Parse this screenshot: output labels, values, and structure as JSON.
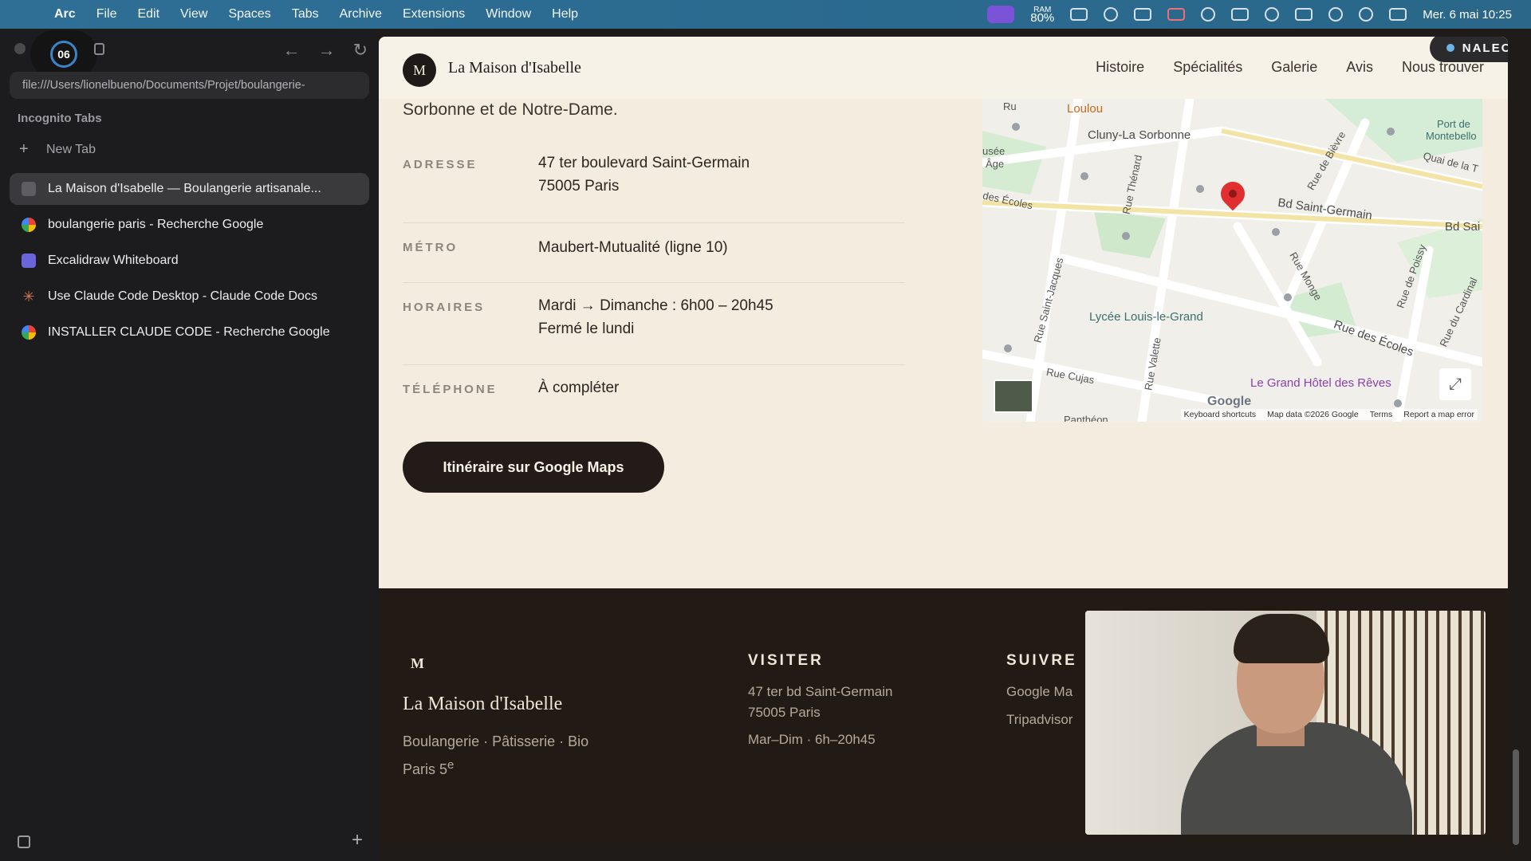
{
  "menubar": {
    "app": "Arc",
    "items": [
      "File",
      "Edit",
      "View",
      "Spaces",
      "Tabs",
      "Archive",
      "Extensions",
      "Window",
      "Help"
    ],
    "ram_label": "RAM",
    "ram_value": "80%",
    "datetime": "Mer. 6 mai  10:25"
  },
  "sidebar": {
    "timer": "06",
    "url": "file:///Users/lionelbueno/Documents/Projet/boulangerie-",
    "section_label": "Incognito Tabs",
    "new_tab": "New Tab",
    "tabs": [
      {
        "label": "La Maison d'Isabelle — Boulangerie artisanale...",
        "icon": "page-icon"
      },
      {
        "label": "boulangerie paris - Recherche Google",
        "icon": "google-icon"
      },
      {
        "label": "Excalidraw Whiteboard",
        "icon": "excalidraw-icon"
      },
      {
        "label": "Use Claude Code Desktop - Claude Code Docs",
        "icon": "claude-icon"
      },
      {
        "label": "INSTALLER CLAUDE CODE - Recherche Google",
        "icon": "google-icon"
      }
    ]
  },
  "site": {
    "logo_letter": "M",
    "name": "La Maison d'Isabelle",
    "nav": [
      "Histoire",
      "Spécialités",
      "Galerie",
      "Avis",
      "Nous trouver"
    ],
    "record_label": "NALEO",
    "intro": "Sorbonne et de Notre-Dame.",
    "info": [
      {
        "label": "ADRESSE",
        "line1": "47 ter boulevard Saint-Germain",
        "line2": "75005 Paris"
      },
      {
        "label": "MÉTRO",
        "line1": "Maubert-Mutualité (ligne 10)",
        "line2": ""
      },
      {
        "label": "HORAIRES",
        "line1": "Mardi → Dimanche : 6h00 – 20h45",
        "line2": "Fermé le lundi"
      },
      {
        "label": "TÉLÉPHONE",
        "line1": "À compléter",
        "line2": ""
      }
    ],
    "cta": "Itinéraire sur Google Maps"
  },
  "map": {
    "labels": {
      "loulou": "Loulou",
      "cluny": "Cluny-La Sorbonne",
      "musee": "usée",
      "age": "Âge",
      "ecoles": "des Écoles",
      "thenard": "Rue Thénard",
      "bd_sg": "Bd Saint-Germain",
      "bd_sai": "Bd Sai",
      "bievre": "Rue de Bièvre",
      "quai": "Quai de la T",
      "port": "Port de",
      "montebello": "Montebello",
      "st_jacques": "Rue Saint-Jacques",
      "monge": "Rue Monge",
      "poissy": "Rue de Poissy",
      "lycee": "Lycée Louis-le-Grand",
      "rue_ecoles": "Rue des Écoles",
      "cardinal": "Rue du Cardinal",
      "cujas": "Rue Cujas",
      "valette": "Rue Valette",
      "hotel": "Le Grand Hôtel des Rêves",
      "pantheon": "Panthéon",
      "ru": "Ru"
    },
    "google": "Google",
    "footer": [
      "Keyboard shortcuts",
      "Map data ©2026 Google",
      "Terms",
      "Report a map error"
    ]
  },
  "footer": {
    "logo_letter": "M",
    "name": "La Maison d'Isabelle",
    "tagline": "Boulangerie · Pâtisserie · Bio",
    "city": "Paris 5",
    "city_sup": "e",
    "visit_title": "VISITER",
    "visit_address1": "47 ter bd Saint-Germain",
    "visit_address2": "75005 Paris",
    "visit_hours": "Mar–Dim · 6h–20h45",
    "follow_title": "SUIVRE",
    "follow_links": [
      "Google Ma",
      "Tripadvisor"
    ]
  },
  "colors": {
    "cream": "#f3ecdf",
    "dark": "#221a15",
    "accent_pin": "#e12f2f"
  }
}
